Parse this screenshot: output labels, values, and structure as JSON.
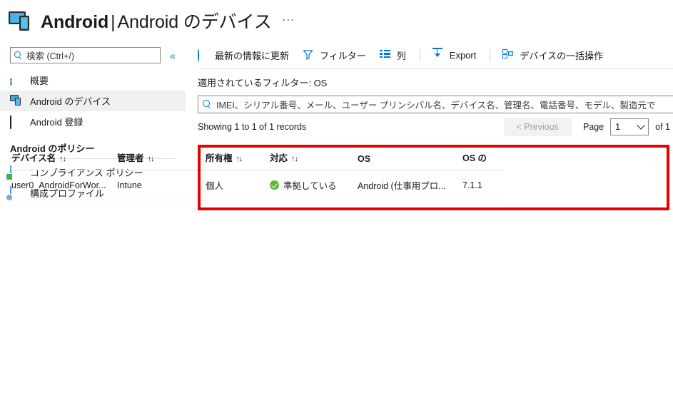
{
  "header": {
    "icon": "devices-icon",
    "title_bold": "Android",
    "title_separator": "|",
    "title_light": "Android のデバイス",
    "ellipsis": "..."
  },
  "sidebar": {
    "search": {
      "icon": "search-icon",
      "placeholder": "検索 (Ctrl+/)",
      "value": ""
    },
    "collapse_label": "«",
    "items": [
      {
        "icon": "info-icon",
        "label": "概要",
        "selected": false
      },
      {
        "icon": "devices-icon",
        "label": "Android のデバイス",
        "selected": true
      },
      {
        "icon": "enrollment-icon",
        "label": "Android 登録",
        "selected": false
      }
    ],
    "section_title": "Android のポリシー",
    "policy_items": [
      {
        "icon": "compliance-policy-icon",
        "label": "コンプライアンス ポリシー"
      },
      {
        "icon": "configuration-profile-icon",
        "label": "構成プロファイル"
      }
    ]
  },
  "toolbar": {
    "commands": [
      {
        "icon": "refresh-icon",
        "label": "最新の情報に更新"
      },
      {
        "icon": "filter-icon",
        "label": "フィルター"
      },
      {
        "icon": "columns-icon",
        "label": "列"
      }
    ],
    "export": {
      "icon": "export-icon",
      "label": "Export"
    },
    "bulk": {
      "icon": "bulk-device-actions-icon",
      "label": "デバイスの一括操作"
    }
  },
  "main": {
    "filter_applied": "適用されているフィルター: OS",
    "search": {
      "icon": "search-icon",
      "placeholder": "IMEI、シリアル番号、メール、ユーザー プリンシパル名、デバイス名、管理名、電話番号、モデル、製造元で",
      "value": ""
    },
    "records_text": "Showing 1 to 1 of 1 records",
    "pagination": {
      "previous_label": "< Previous",
      "page_label": "Page",
      "page_value": "1",
      "page_options": [
        "1"
      ],
      "of_label": "of 1"
    }
  },
  "table": {
    "sort_glyph": "↑↓",
    "columns": [
      {
        "label": "デバイス名",
        "sortable": true
      },
      {
        "label": "管理者",
        "sortable": true
      },
      {
        "label": "所有権",
        "sortable": true
      },
      {
        "label": "対応",
        "sortable": true
      },
      {
        "label": "OS",
        "sortable": false
      },
      {
        "label": "OS の",
        "sortable": false
      }
    ],
    "rows": [
      {
        "device_name": "user0_AndroidForWor...",
        "managed_by": "Intune",
        "ownership": "個人",
        "compliance_icon": "compliant-check-icon",
        "compliance": "準拠している",
        "os": "Android (仕事用プロ...",
        "os_version": "7.1.1"
      }
    ]
  },
  "highlight": {
    "color": "#e60000"
  }
}
